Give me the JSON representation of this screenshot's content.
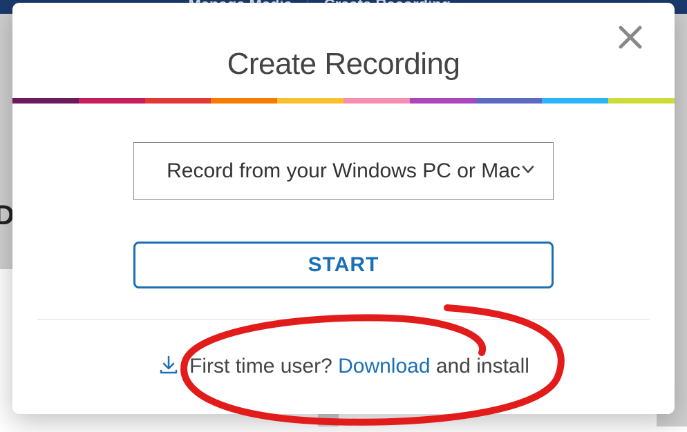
{
  "header": {
    "manage_media": "Manage Media",
    "create_recording": "Create Recording"
  },
  "modal": {
    "title": "Create Recording",
    "dropdown": {
      "selected": "Record from your Windows PC or Mac"
    },
    "start_label": "START",
    "first_time": {
      "prefix": "First time user? ",
      "link": "Download",
      "suffix": " and install"
    }
  },
  "rainbow_colors": [
    "#6a1b5d",
    "#c81d5e",
    "#e53935",
    "#f57c00",
    "#fbc02d",
    "#f48fb1",
    "#ab47bc",
    "#5c6bc0",
    "#29b6f6",
    "#cddc39"
  ]
}
